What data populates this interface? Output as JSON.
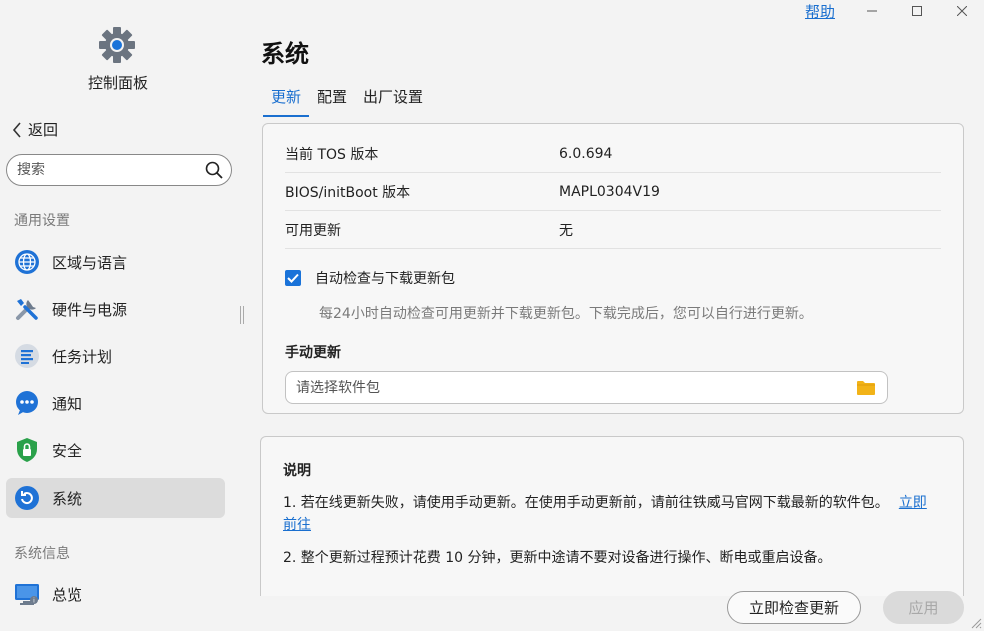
{
  "sidebar": {
    "app_title": "控制面板",
    "back_label": "返回",
    "search_placeholder": "搜索",
    "section_general": "通用设置",
    "items": [
      {
        "label": "区域与语言",
        "icon": "globe-icon"
      },
      {
        "label": "硬件与电源",
        "icon": "tools-icon"
      },
      {
        "label": "任务计划",
        "icon": "task-list-icon"
      },
      {
        "label": "通知",
        "icon": "chat-bubble-icon"
      },
      {
        "label": "安全",
        "icon": "shield-icon"
      },
      {
        "label": "系统",
        "icon": "system-refresh-icon"
      }
    ],
    "active_item": "系统",
    "section_info": "系统信息",
    "info_items": [
      {
        "label": "总览",
        "icon": "monitor-icon"
      }
    ]
  },
  "topbar": {
    "help_label": "帮助"
  },
  "main": {
    "title": "系统",
    "tabs": [
      {
        "label": "更新",
        "active": true
      },
      {
        "label": "配置",
        "active": false
      },
      {
        "label": "出厂设置",
        "active": false
      }
    ],
    "info": [
      {
        "key": "当前 TOS 版本",
        "value": "6.0.694"
      },
      {
        "key": "BIOS/initBoot 版本",
        "value": "MAPL0304V19"
      },
      {
        "key": "可用更新",
        "value": "无"
      }
    ],
    "auto_update": {
      "checked": true,
      "label": "自动检查与下载更新包",
      "hint": "每24小时自动检查可用更新并下载更新包。下载完成后，您可以自行进行更新。"
    },
    "manual": {
      "title": "手动更新",
      "placeholder": "请选择软件包"
    },
    "notes": {
      "title": "说明",
      "note1_text": "1. 若在线更新失败，请使用手动更新。在使用手动更新前，请前往铁威马官网下载最新的软件包。",
      "note1_link": "立即前往",
      "note2_text": "2. 整个更新过程预计花费 10 分钟，更新中途请不要对设备进行操作、断电或重启设备。"
    },
    "buttons": {
      "check_now": "立即检查更新",
      "apply": "应用"
    }
  },
  "colors": {
    "accent": "#1a6fcf",
    "checkbox": "#1a73d9",
    "folder": "#f2b318"
  }
}
